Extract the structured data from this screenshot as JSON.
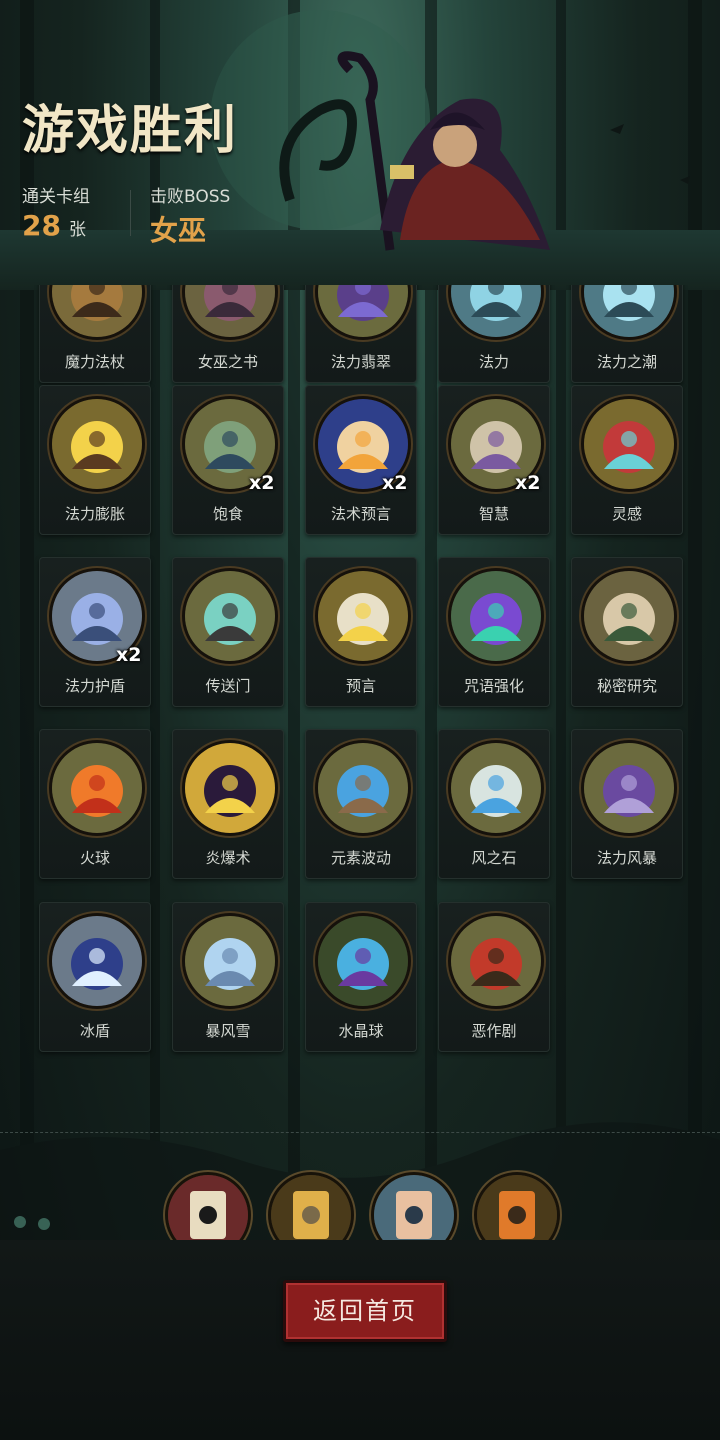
{
  "header": {
    "title": "游戏胜利",
    "cleared_deck_label": "通关卡组",
    "cleared_deck_count": "28",
    "cleared_deck_unit": "张",
    "boss_label": "击败BOSS",
    "boss_name": "女巫"
  },
  "cards": [
    {
      "name": "魔力法杖",
      "icon": "staff-icon",
      "badge": ""
    },
    {
      "name": "女巫之书",
      "icon": "book-icon",
      "badge": ""
    },
    {
      "name": "法力翡翠",
      "icon": "emerald-icon",
      "badge": ""
    },
    {
      "name": "法力",
      "icon": "mana-icon",
      "badge": ""
    },
    {
      "name": "法力之潮",
      "icon": "tide-icon",
      "badge": ""
    },
    {
      "name": "法力膨胀",
      "icon": "mana-surge-icon",
      "badge": ""
    },
    {
      "name": "饱食",
      "icon": "feast-icon",
      "badge": "x2"
    },
    {
      "name": "法术预言",
      "icon": "orb-prophecy-icon",
      "badge": "x2"
    },
    {
      "name": "智慧",
      "icon": "sage-icon",
      "badge": "x2"
    },
    {
      "name": "灵感",
      "icon": "skull-icon",
      "badge": ""
    },
    {
      "name": "法力护盾",
      "icon": "shield-icon",
      "badge": "x2"
    },
    {
      "name": "传送门",
      "icon": "portal-icon",
      "badge": ""
    },
    {
      "name": "预言",
      "icon": "prophet-icon",
      "badge": ""
    },
    {
      "name": "咒语强化",
      "icon": "crystal-icon",
      "badge": ""
    },
    {
      "name": "秘密研究",
      "icon": "scholar-icon",
      "badge": ""
    },
    {
      "name": "火球",
      "icon": "fireball-icon",
      "badge": ""
    },
    {
      "name": "炎爆术",
      "icon": "bat-blast-icon",
      "badge": ""
    },
    {
      "name": "元素波动",
      "icon": "elemental-icon",
      "badge": ""
    },
    {
      "name": "风之石",
      "icon": "wind-stone-icon",
      "badge": ""
    },
    {
      "name": "法力风暴",
      "icon": "storm-icon",
      "badge": ""
    },
    {
      "name": "冰盾",
      "icon": "ice-wizard-icon",
      "badge": ""
    },
    {
      "name": "暴风雪",
      "icon": "blizzard-icon",
      "badge": ""
    },
    {
      "name": "水晶球",
      "icon": "crystal-ball-icon",
      "badge": ""
    },
    {
      "name": "恶作剧",
      "icon": "prank-doll-icon",
      "badge": ""
    }
  ],
  "relics": [
    {
      "icon": "skull-card-icon"
    },
    {
      "icon": "hourglass-icon"
    },
    {
      "icon": "hand-cards-icon"
    },
    {
      "icon": "pumpkin-scarecrow-icon"
    }
  ],
  "footer": {
    "home_button_label": "返回首页"
  },
  "colors": {
    "accent_gold": "#e2a24a",
    "button_red": "#8a1d1d",
    "medal_rim": "#4a3b22"
  }
}
